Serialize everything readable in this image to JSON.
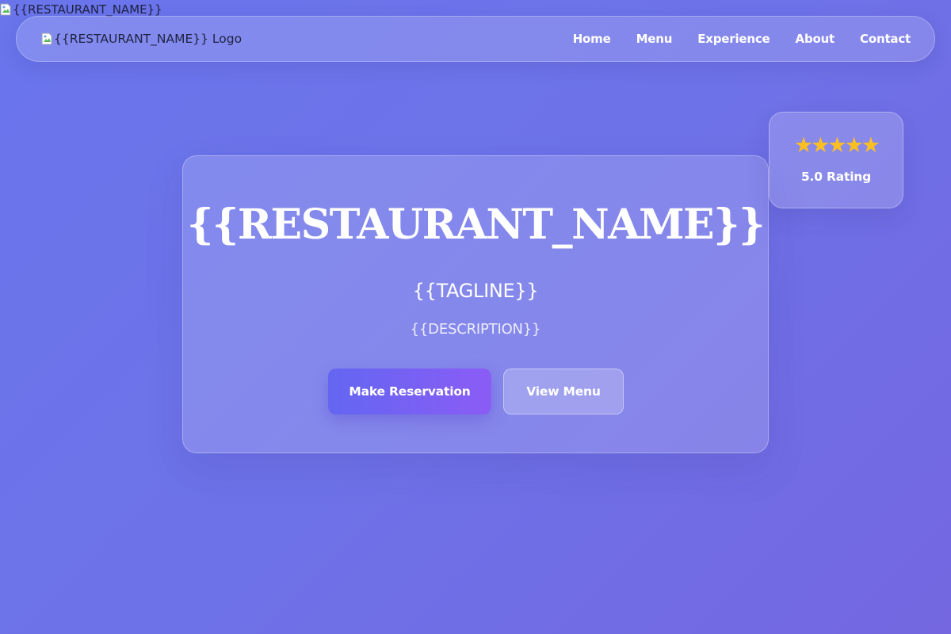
{
  "page": {
    "corner_image_alt": "{{RESTAURANT_NAME}}"
  },
  "navbar": {
    "logo_alt": "{{RESTAURANT_NAME}} Logo",
    "links": [
      {
        "label": "Home"
      },
      {
        "label": "Menu"
      },
      {
        "label": "Experience"
      },
      {
        "label": "About"
      },
      {
        "label": "Contact"
      }
    ]
  },
  "hero": {
    "title": "{{RESTAURANT_NAME}}",
    "tagline": "{{TAGLINE}}",
    "description": "{{DESCRIPTION}}",
    "primary_button_label": "Make Reservation",
    "secondary_button_label": "View Menu"
  },
  "rating": {
    "stars": "★★★★★",
    "star_count": 5,
    "label": "5.0 Rating"
  },
  "colors": {
    "background_start": "#6a75ec",
    "background_end": "#7467e0",
    "button_gradient_start": "#6366f1",
    "button_gradient_end": "#8b5cf6",
    "star": "#fbbf24",
    "text": "#ffffff"
  },
  "icons": {
    "corner_image": "broken-image-icon",
    "logo_image": "broken-image-icon",
    "rating": "star-icon"
  }
}
